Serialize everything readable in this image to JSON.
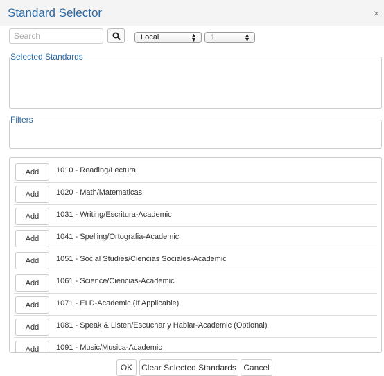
{
  "dialog": {
    "title": "Standard Selector",
    "close_glyph": "×"
  },
  "toolbar": {
    "search_placeholder": "Search",
    "search_icon": "search-icon",
    "scope_select_value": "Local",
    "level_select_value": "1"
  },
  "sections": {
    "selected_label": "Selected Standards",
    "filters_label": "Filters"
  },
  "standards": {
    "add_label": "Add",
    "items": [
      "1010 - Reading/Lectura",
      "1020 - Math/Matematicas",
      "1031 - Writing/Escritura-Academic",
      "1041 - Spelling/Ortografia-Academic",
      "1051 - Social Studies/Ciencias Sociales-Academic",
      "1061 - Science/Ciencias-Academic",
      "1071 - ELD-Academic (If Applicable)",
      "1081 - Speak & Listen/Escuchar y Hablar-Academic (Optional)",
      "1091 - Music/Musica-Academic"
    ]
  },
  "footer": {
    "ok_label": "OK",
    "clear_label": "Clear Selected Standards",
    "cancel_label": "Cancel"
  },
  "colors": {
    "accent": "#2a6aa6",
    "header_bg": "#f4f4f4",
    "border": "#cccccc"
  }
}
